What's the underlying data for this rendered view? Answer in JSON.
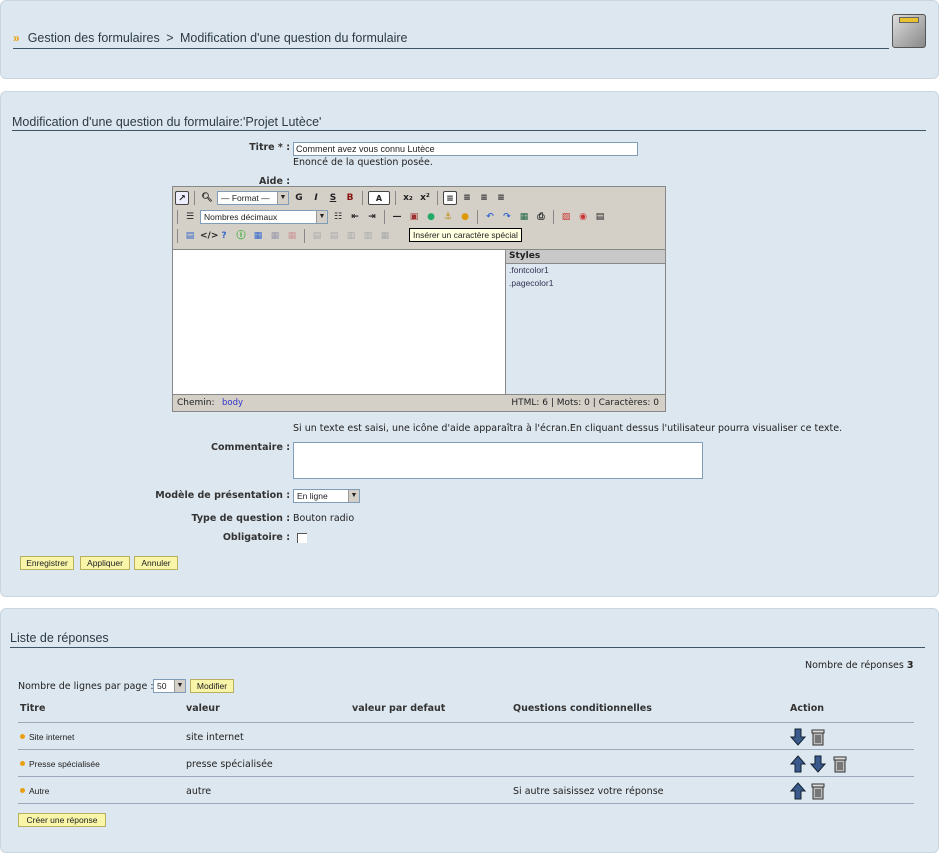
{
  "header": {
    "breadcrumb_root": "Gestion des formulaires",
    "breadcrumb_sep": ">",
    "breadcrumb_current": "Modification d'une question du formulaire",
    "module_icon": "puzzle-icon"
  },
  "edit_form": {
    "title": "Modification d'une question du formulaire:'Projet Lutèce'",
    "titre_label": "Titre * :",
    "titre_value": "Comment avez vous connu Lutèce",
    "titre_hint": "Enoncé de la question posée.",
    "aide_label": "Aide :",
    "editor": {
      "format_select": "— Format —",
      "list_select": "Nombres décimaux",
      "bold": "G",
      "italic": "I",
      "strike": "S",
      "bold2": "B",
      "tooltip": "Insérer un caractère spécial",
      "styles_header": "Styles",
      "styles_items": [
        ".fontcolor1",
        ".pagecolor1"
      ],
      "path_label": "Chemin:",
      "path_value": "body",
      "stats": "HTML: 6 | Mots: 0 | Caractères: 0"
    },
    "aide_hint": "Si un texte est saisi, une icône d'aide apparaîtra à l'écran.En cliquant dessus l'utilisateur pourra visualiser ce texte.",
    "commentaire_label": "Commentaire :",
    "commentaire_value": "",
    "modele_label": "Modèle de présentation :",
    "modele_value": "En ligne",
    "type_label": "Type de question :",
    "type_value": "Bouton radio",
    "obligatoire_label": "Obligatoire :",
    "buttons": {
      "save": "Enregistrer",
      "apply": "Appliquer",
      "cancel": "Annuler"
    }
  },
  "responses": {
    "title": "Liste de réponses",
    "count_label": "Nombre de réponses",
    "count_value": "3",
    "per_page_label": "Nombre de lignes par page :",
    "per_page_value": "50",
    "modify_button": "Modifier",
    "columns": [
      "Titre",
      "valeur",
      "valeur par defaut",
      "Questions conditionnelles",
      "Action"
    ],
    "rows": [
      {
        "titre": "Site internet",
        "valeur": "site internet",
        "defaut": "",
        "conditionnelles": "",
        "actions": [
          "arrow-down-icon",
          "trash-icon"
        ]
      },
      {
        "titre": "Presse spécialisée",
        "valeur": "presse spécialisée",
        "defaut": "",
        "conditionnelles": "",
        "actions": [
          "arrow-up-icon",
          "arrow-down-icon",
          "trash-icon"
        ]
      },
      {
        "titre": "Autre",
        "valeur": "autre",
        "defaut": "",
        "conditionnelles": "Si autre saisissez votre réponse",
        "actions": [
          "arrow-up-icon",
          "trash-icon"
        ]
      }
    ],
    "create_button": "Créer une réponse"
  },
  "colors": {
    "panel_bg": "#dde7ef",
    "button_bg": "#f8f4a8",
    "bullet": "#e8a010",
    "heading": "#2c3a46"
  }
}
